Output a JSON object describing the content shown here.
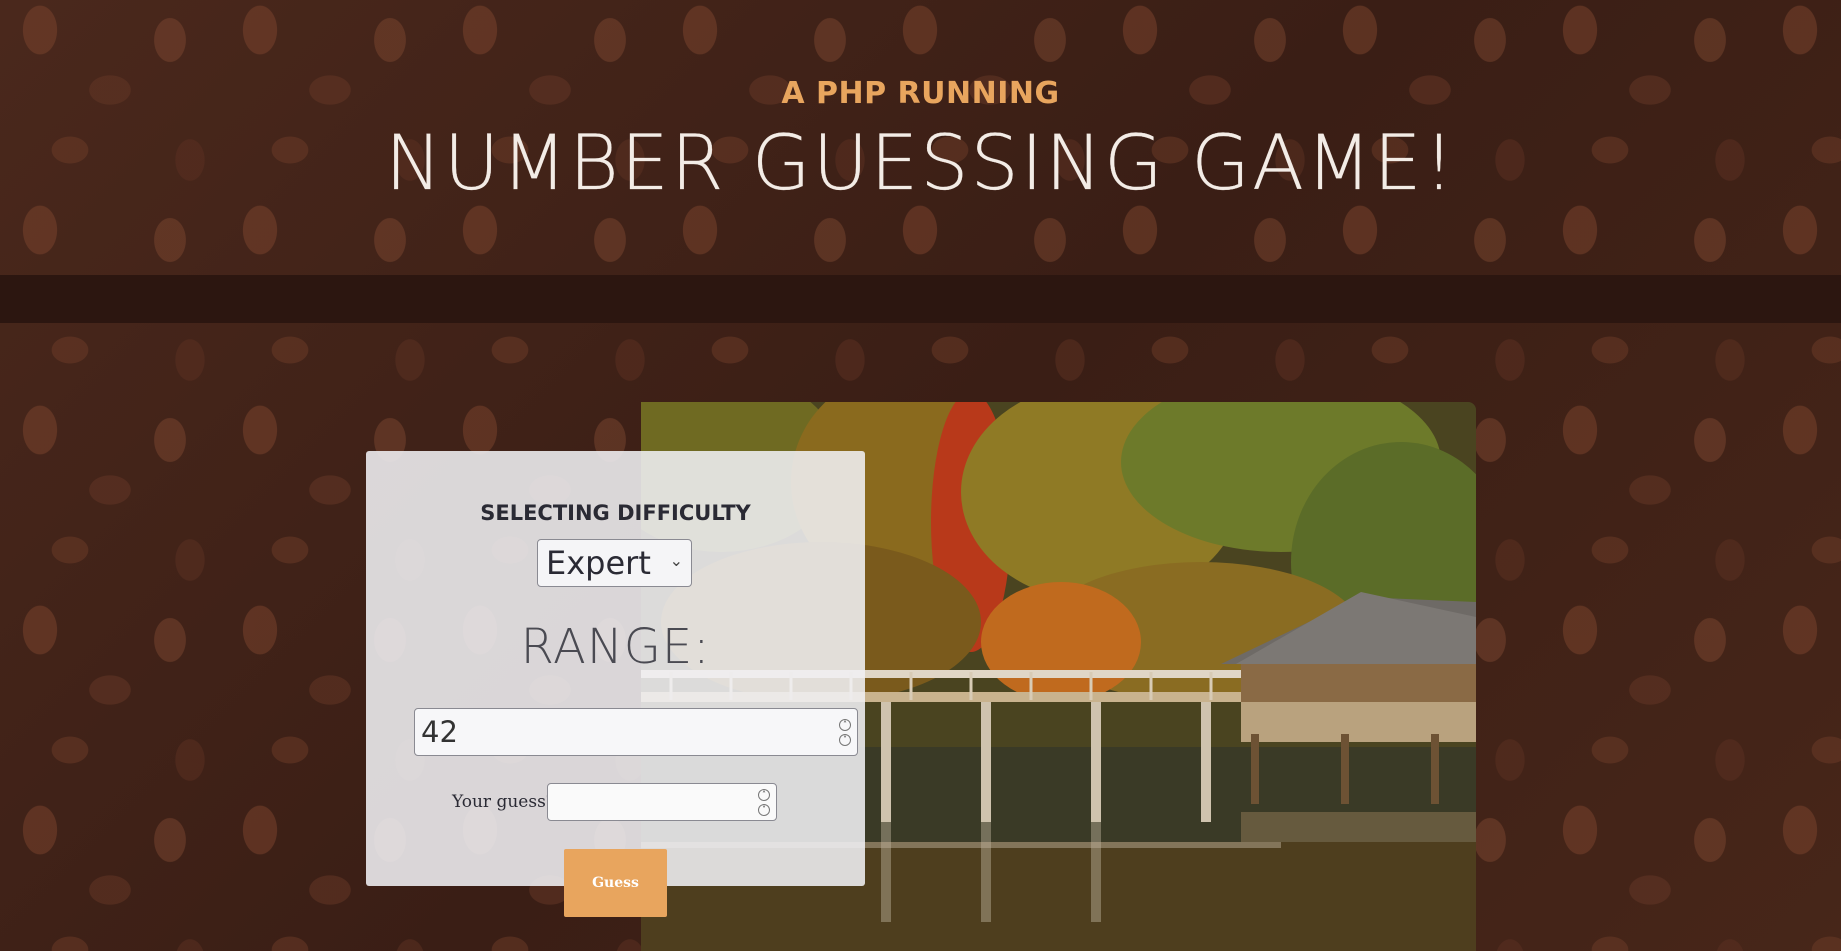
{
  "header": {
    "subtitle": "A PHP RUNNING",
    "title": "NUMBER GUESSING GAME!"
  },
  "difficulty": {
    "heading": "SELECTING DIFFICULTY",
    "selected": "Expert"
  },
  "range": {
    "label": "RANGE:",
    "value": "42"
  },
  "guess": {
    "label": "Your guess?",
    "value": ""
  },
  "actions": {
    "guess_button": "Guess"
  },
  "colors": {
    "accent": "#e8a55e",
    "band": "#2c1610",
    "panel": "#f0f0f4"
  }
}
